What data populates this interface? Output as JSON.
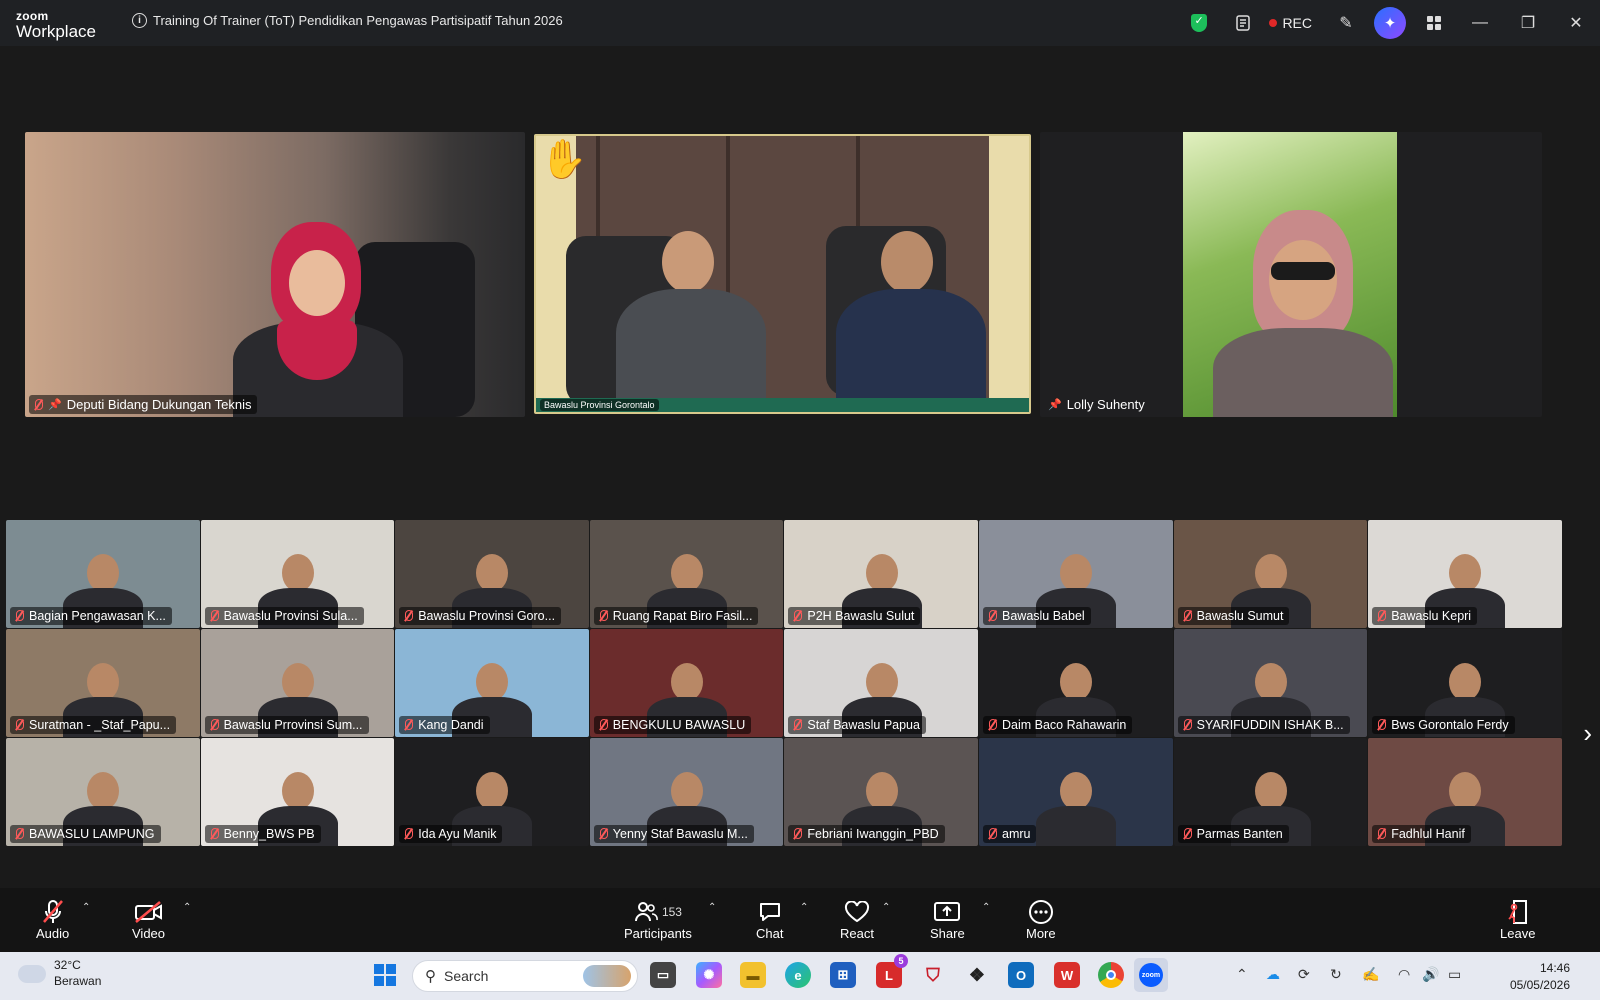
{
  "app": {
    "brand_top": "zoom",
    "brand_bottom": "Workplace"
  },
  "meeting": {
    "title": "Training Of Trainer (ToT) Pendidikan Pengawas Partisipatif Tahun 2026"
  },
  "titlebar": {
    "rec_label": "REC",
    "icons": [
      "security-shield-icon",
      "notes-icon",
      "recording-icon",
      "annotate-icon",
      "ai-companion-icon",
      "apps-icon",
      "minimize-icon",
      "restore-icon",
      "close-icon"
    ]
  },
  "featured": [
    {
      "name": "Deputi Bidang Dukungan Teknis",
      "muted": true,
      "pinned": true
    },
    {
      "name": "Bawaslu Provinsi Gorontalo",
      "muted": false,
      "raised_hand": true
    },
    {
      "name": "Lolly Suhenty",
      "muted": false,
      "pinned": true
    }
  ],
  "gallery": [
    "Bagian Pengawasan K...",
    "Bawaslu Provinsi Sula...",
    "Bawaslu Provinsi Goro...",
    "Ruang Rapat Biro Fasil...",
    "P2H Bawaslu Sulut",
    "Bawaslu Babel",
    "Bawaslu Sumut",
    "Bawaslu Kepri",
    "Suratman - _Staf_Papu...",
    "Bawaslu Prrovinsi Sum...",
    "Kang Dandi",
    "BENGKULU BAWASLU",
    "Staf Bawaslu Papua",
    "Daim Baco Rahawarin",
    "SYARIFUDDIN ISHAK B...",
    "Bws Gorontalo Ferdy",
    "BAWASLU LAMPUNG",
    "Benny_BWS PB",
    "Ida Ayu Manik",
    "Yenny Staf Bawaslu M...",
    "Febriani Iwanggin_PBD",
    "amru",
    "Parmas Banten",
    "Fadhlul Hanif"
  ],
  "toolbar": {
    "audio": "Audio",
    "video": "Video",
    "participants": "Participants",
    "participants_count": "153",
    "chat": "Chat",
    "react": "React",
    "share": "Share",
    "more": "More",
    "leave": "Leave"
  },
  "taskbar": {
    "temp": "32°C",
    "weather": "Berawan",
    "search_placeholder": "Search",
    "time": "14:46",
    "date": "05/05/2026",
    "badge": "5"
  }
}
